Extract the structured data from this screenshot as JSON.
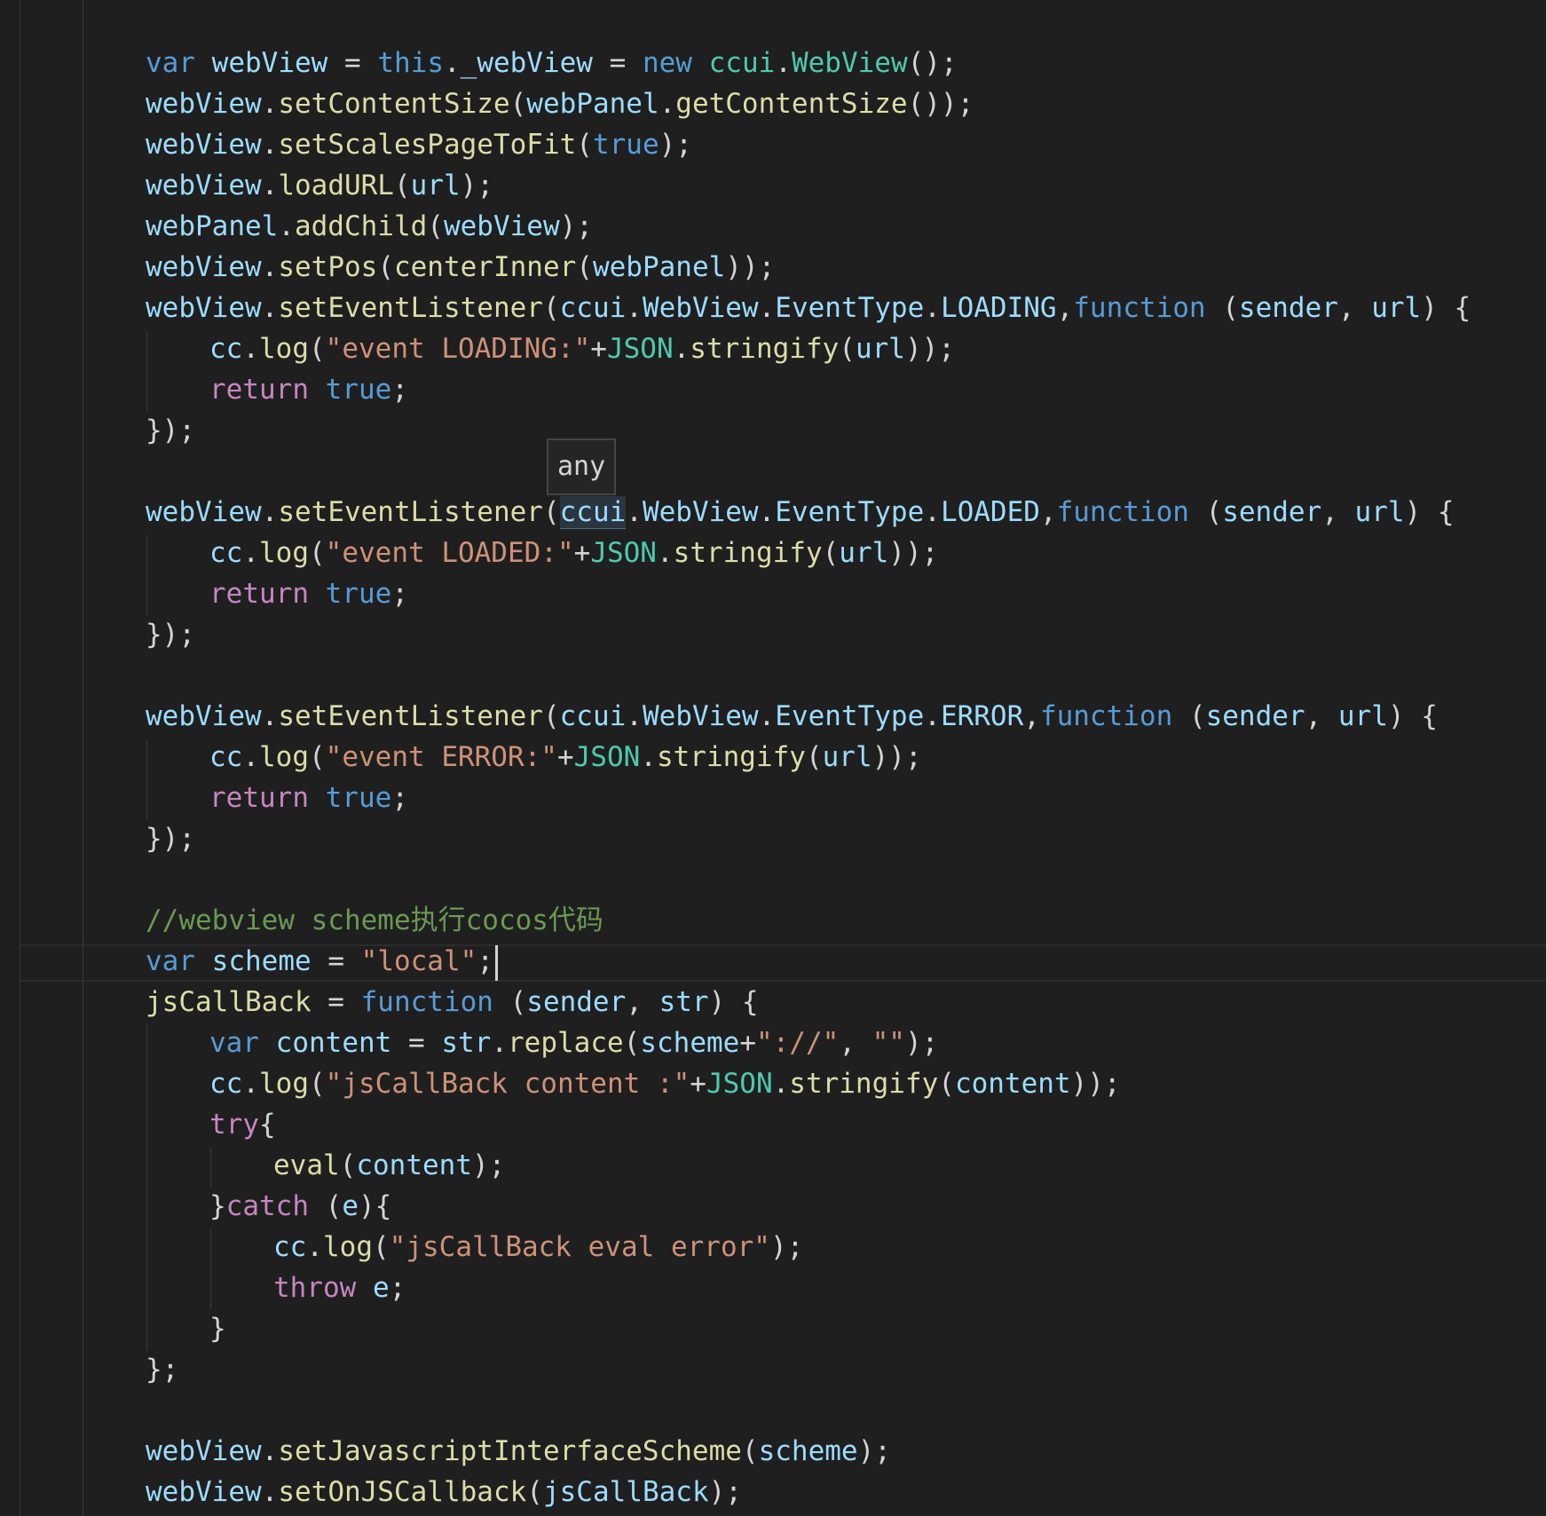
{
  "editor": {
    "tooltip": "any",
    "lines": [
      {
        "id": "l1",
        "indent": 0,
        "tokens": [
          {
            "t": "var",
            "c": "kw"
          },
          {
            "t": " "
          },
          {
            "t": "webView",
            "c": "var"
          },
          {
            "t": " = "
          },
          {
            "t": "this",
            "c": "kw"
          },
          {
            "t": "."
          },
          {
            "t": "_webView",
            "c": "var"
          },
          {
            "t": " = "
          },
          {
            "t": "new",
            "c": "kw"
          },
          {
            "t": " "
          },
          {
            "t": "ccui",
            "c": "type"
          },
          {
            "t": "."
          },
          {
            "t": "WebView",
            "c": "type"
          },
          {
            "t": "();"
          }
        ]
      },
      {
        "id": "l2",
        "indent": 0,
        "tokens": [
          {
            "t": "webView",
            "c": "var"
          },
          {
            "t": "."
          },
          {
            "t": "setContentSize",
            "c": "fn"
          },
          {
            "t": "("
          },
          {
            "t": "webPanel",
            "c": "var"
          },
          {
            "t": "."
          },
          {
            "t": "getContentSize",
            "c": "fn"
          },
          {
            "t": "());"
          }
        ]
      },
      {
        "id": "l3",
        "indent": 0,
        "tokens": [
          {
            "t": "webView",
            "c": "var"
          },
          {
            "t": "."
          },
          {
            "t": "setScalesPageToFit",
            "c": "fn"
          },
          {
            "t": "("
          },
          {
            "t": "true",
            "c": "kw"
          },
          {
            "t": ");"
          }
        ]
      },
      {
        "id": "l4",
        "indent": 0,
        "tokens": [
          {
            "t": "webView",
            "c": "var"
          },
          {
            "t": "."
          },
          {
            "t": "loadURL",
            "c": "fn"
          },
          {
            "t": "("
          },
          {
            "t": "url",
            "c": "var"
          },
          {
            "t": ");"
          }
        ]
      },
      {
        "id": "l5",
        "indent": 0,
        "tokens": [
          {
            "t": "webPanel",
            "c": "var"
          },
          {
            "t": "."
          },
          {
            "t": "addChild",
            "c": "fn"
          },
          {
            "t": "("
          },
          {
            "t": "webView",
            "c": "var"
          },
          {
            "t": ");"
          }
        ]
      },
      {
        "id": "l6",
        "indent": 0,
        "tokens": [
          {
            "t": "webView",
            "c": "var"
          },
          {
            "t": "."
          },
          {
            "t": "setPos",
            "c": "fn"
          },
          {
            "t": "("
          },
          {
            "t": "centerInner",
            "c": "fn"
          },
          {
            "t": "("
          },
          {
            "t": "webPanel",
            "c": "var"
          },
          {
            "t": "));"
          }
        ]
      },
      {
        "id": "l7",
        "indent": 0,
        "tokens": [
          {
            "t": "webView",
            "c": "var"
          },
          {
            "t": "."
          },
          {
            "t": "setEventListener",
            "c": "fn"
          },
          {
            "t": "("
          },
          {
            "t": "ccui",
            "c": "var"
          },
          {
            "t": "."
          },
          {
            "t": "WebView",
            "c": "var"
          },
          {
            "t": "."
          },
          {
            "t": "EventType",
            "c": "var"
          },
          {
            "t": "."
          },
          {
            "t": "LOADING",
            "c": "var"
          },
          {
            "t": ","
          },
          {
            "t": "function",
            "c": "kw"
          },
          {
            "t": " ("
          },
          {
            "t": "sender",
            "c": "var"
          },
          {
            "t": ", "
          },
          {
            "t": "url",
            "c": "var"
          },
          {
            "t": ") {"
          }
        ]
      },
      {
        "id": "l8",
        "indent": 1,
        "tokens": [
          {
            "t": "cc",
            "c": "var"
          },
          {
            "t": "."
          },
          {
            "t": "log",
            "c": "fn"
          },
          {
            "t": "("
          },
          {
            "t": "\"event LOADING:\"",
            "c": "str"
          },
          {
            "t": "+"
          },
          {
            "t": "JSON",
            "c": "type"
          },
          {
            "t": "."
          },
          {
            "t": "stringify",
            "c": "fn"
          },
          {
            "t": "("
          },
          {
            "t": "url",
            "c": "var"
          },
          {
            "t": "));"
          }
        ]
      },
      {
        "id": "l9",
        "indent": 1,
        "tokens": [
          {
            "t": "return",
            "c": "ctrl"
          },
          {
            "t": " "
          },
          {
            "t": "true",
            "c": "kw"
          },
          {
            "t": ";"
          }
        ]
      },
      {
        "id": "l10",
        "indent": 0,
        "tokens": [
          {
            "t": "});"
          }
        ]
      },
      {
        "id": "l11",
        "indent": 0,
        "tokens": []
      },
      {
        "id": "l12",
        "indent": 0,
        "tokens": [
          {
            "t": "webView",
            "c": "var"
          },
          {
            "t": "."
          },
          {
            "t": "setEventListener",
            "c": "fn"
          },
          {
            "t": "("
          },
          {
            "t": "ccui",
            "c": "var",
            "hover": true
          },
          {
            "t": "."
          },
          {
            "t": "WebView",
            "c": "var"
          },
          {
            "t": "."
          },
          {
            "t": "EventType",
            "c": "var"
          },
          {
            "t": "."
          },
          {
            "t": "LOADED",
            "c": "var"
          },
          {
            "t": ","
          },
          {
            "t": "function",
            "c": "kw"
          },
          {
            "t": " ("
          },
          {
            "t": "sender",
            "c": "var"
          },
          {
            "t": ", "
          },
          {
            "t": "url",
            "c": "var"
          },
          {
            "t": ") {"
          }
        ]
      },
      {
        "id": "l13",
        "indent": 1,
        "tokens": [
          {
            "t": "cc",
            "c": "var"
          },
          {
            "t": "."
          },
          {
            "t": "log",
            "c": "fn"
          },
          {
            "t": "("
          },
          {
            "t": "\"event LOADED:\"",
            "c": "str"
          },
          {
            "t": "+"
          },
          {
            "t": "JSON",
            "c": "type"
          },
          {
            "t": "."
          },
          {
            "t": "stringify",
            "c": "fn"
          },
          {
            "t": "("
          },
          {
            "t": "url",
            "c": "var"
          },
          {
            "t": "));"
          }
        ]
      },
      {
        "id": "l14",
        "indent": 1,
        "tokens": [
          {
            "t": "return",
            "c": "ctrl"
          },
          {
            "t": " "
          },
          {
            "t": "true",
            "c": "kw"
          },
          {
            "t": ";"
          }
        ]
      },
      {
        "id": "l15",
        "indent": 0,
        "tokens": [
          {
            "t": "});"
          }
        ]
      },
      {
        "id": "l16",
        "indent": 0,
        "tokens": []
      },
      {
        "id": "l17",
        "indent": 0,
        "tokens": [
          {
            "t": "webView",
            "c": "var"
          },
          {
            "t": "."
          },
          {
            "t": "setEventListener",
            "c": "fn"
          },
          {
            "t": "("
          },
          {
            "t": "ccui",
            "c": "var"
          },
          {
            "t": "."
          },
          {
            "t": "WebView",
            "c": "var"
          },
          {
            "t": "."
          },
          {
            "t": "EventType",
            "c": "var"
          },
          {
            "t": "."
          },
          {
            "t": "ERROR",
            "c": "var"
          },
          {
            "t": ","
          },
          {
            "t": "function",
            "c": "kw"
          },
          {
            "t": " ("
          },
          {
            "t": "sender",
            "c": "var"
          },
          {
            "t": ", "
          },
          {
            "t": "url",
            "c": "var"
          },
          {
            "t": ") {"
          }
        ]
      },
      {
        "id": "l18",
        "indent": 1,
        "tokens": [
          {
            "t": "cc",
            "c": "var"
          },
          {
            "t": "."
          },
          {
            "t": "log",
            "c": "fn"
          },
          {
            "t": "("
          },
          {
            "t": "\"event ERROR:\"",
            "c": "str"
          },
          {
            "t": "+"
          },
          {
            "t": "JSON",
            "c": "type"
          },
          {
            "t": "."
          },
          {
            "t": "stringify",
            "c": "fn"
          },
          {
            "t": "("
          },
          {
            "t": "url",
            "c": "var"
          },
          {
            "t": "));"
          }
        ]
      },
      {
        "id": "l19",
        "indent": 1,
        "tokens": [
          {
            "t": "return",
            "c": "ctrl"
          },
          {
            "t": " "
          },
          {
            "t": "true",
            "c": "kw"
          },
          {
            "t": ";"
          }
        ]
      },
      {
        "id": "l20",
        "indent": 0,
        "tokens": [
          {
            "t": "});"
          }
        ]
      },
      {
        "id": "l21",
        "indent": 0,
        "tokens": []
      },
      {
        "id": "l22",
        "indent": 0,
        "tokens": [
          {
            "t": "//webview scheme执行cocos代码",
            "c": "com"
          }
        ]
      },
      {
        "id": "l23",
        "indent": 0,
        "cursor": true,
        "tokens": [
          {
            "t": "var",
            "c": "kw"
          },
          {
            "t": " "
          },
          {
            "t": "scheme",
            "c": "var"
          },
          {
            "t": " = "
          },
          {
            "t": "\"local\"",
            "c": "str"
          },
          {
            "t": ";"
          }
        ]
      },
      {
        "id": "l24",
        "indent": 0,
        "tokens": [
          {
            "t": "jsCallBack",
            "c": "fn"
          },
          {
            "t": " = "
          },
          {
            "t": "function",
            "c": "kw"
          },
          {
            "t": " ("
          },
          {
            "t": "sender",
            "c": "var"
          },
          {
            "t": ", "
          },
          {
            "t": "str",
            "c": "var"
          },
          {
            "t": ") {"
          }
        ]
      },
      {
        "id": "l25",
        "indent": 1,
        "tokens": [
          {
            "t": "var",
            "c": "kw"
          },
          {
            "t": " "
          },
          {
            "t": "content",
            "c": "var"
          },
          {
            "t": " = "
          },
          {
            "t": "str",
            "c": "var"
          },
          {
            "t": "."
          },
          {
            "t": "replace",
            "c": "fn"
          },
          {
            "t": "("
          },
          {
            "t": "scheme",
            "c": "var"
          },
          {
            "t": "+"
          },
          {
            "t": "\"://\"",
            "c": "str"
          },
          {
            "t": ", "
          },
          {
            "t": "\"\"",
            "c": "str"
          },
          {
            "t": ");"
          }
        ]
      },
      {
        "id": "l26",
        "indent": 1,
        "tokens": [
          {
            "t": "cc",
            "c": "var"
          },
          {
            "t": "."
          },
          {
            "t": "log",
            "c": "fn"
          },
          {
            "t": "("
          },
          {
            "t": "\"jsCallBack content :\"",
            "c": "str"
          },
          {
            "t": "+"
          },
          {
            "t": "JSON",
            "c": "type"
          },
          {
            "t": "."
          },
          {
            "t": "stringify",
            "c": "fn"
          },
          {
            "t": "("
          },
          {
            "t": "content",
            "c": "var"
          },
          {
            "t": "));"
          }
        ]
      },
      {
        "id": "l27",
        "indent": 1,
        "tokens": [
          {
            "t": "try",
            "c": "ctrl"
          },
          {
            "t": "{"
          }
        ]
      },
      {
        "id": "l28",
        "indent": 2,
        "tokens": [
          {
            "t": "eval",
            "c": "fn"
          },
          {
            "t": "("
          },
          {
            "t": "content",
            "c": "var"
          },
          {
            "t": ");"
          }
        ]
      },
      {
        "id": "l29",
        "indent": 1,
        "tokens": [
          {
            "t": "}"
          },
          {
            "t": "catch",
            "c": "ctrl"
          },
          {
            "t": " ("
          },
          {
            "t": "e",
            "c": "var"
          },
          {
            "t": "){"
          }
        ]
      },
      {
        "id": "l30",
        "indent": 2,
        "tokens": [
          {
            "t": "cc",
            "c": "var"
          },
          {
            "t": "."
          },
          {
            "t": "log",
            "c": "fn"
          },
          {
            "t": "("
          },
          {
            "t": "\"jsCallBack eval error\"",
            "c": "str"
          },
          {
            "t": ");"
          }
        ]
      },
      {
        "id": "l31",
        "indent": 2,
        "tokens": [
          {
            "t": "throw",
            "c": "ctrl"
          },
          {
            "t": " "
          },
          {
            "t": "e",
            "c": "var"
          },
          {
            "t": ";"
          }
        ]
      },
      {
        "id": "l32",
        "indent": 1,
        "tokens": [
          {
            "t": "}"
          }
        ]
      },
      {
        "id": "l33",
        "indent": 0,
        "tokens": [
          {
            "t": "};"
          }
        ]
      },
      {
        "id": "l34",
        "indent": 0,
        "tokens": []
      },
      {
        "id": "l35",
        "indent": 0,
        "tokens": [
          {
            "t": "webView",
            "c": "var"
          },
          {
            "t": "."
          },
          {
            "t": "setJavascriptInterfaceScheme",
            "c": "fn"
          },
          {
            "t": "("
          },
          {
            "t": "scheme",
            "c": "var"
          },
          {
            "t": ");"
          }
        ]
      },
      {
        "id": "l36",
        "indent": 0,
        "tokens": [
          {
            "t": "webView",
            "c": "var"
          },
          {
            "t": "."
          },
          {
            "t": "setOnJSCallback",
            "c": "fn"
          },
          {
            "t": "("
          },
          {
            "t": "jsCallBack",
            "c": "var"
          },
          {
            "t": ");"
          }
        ]
      }
    ]
  }
}
